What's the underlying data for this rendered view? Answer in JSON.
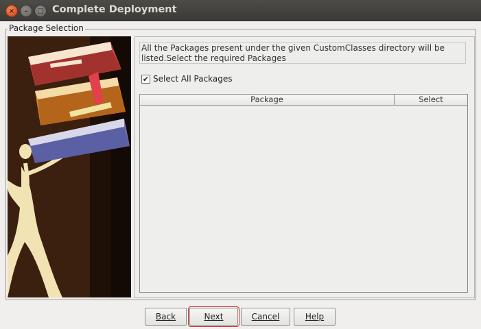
{
  "window": {
    "title": "Complete Deployment"
  },
  "title_buttons": {
    "close": "×",
    "minimize": "–",
    "maximize": "□"
  },
  "package_selection": {
    "legend": "Package Selection",
    "description": "All the Packages present under the given CustomClasses directory will be listed.Select the required Packages",
    "select_all": {
      "label": "Select All Packages",
      "checked": true,
      "check_mark": "✔"
    },
    "table": {
      "columns": [
        "Package",
        "Select"
      ],
      "rows": []
    }
  },
  "buttons": {
    "back": "Back",
    "next": "Next",
    "cancel": "Cancel",
    "help": "Help"
  },
  "colors": {
    "title_bar": "#3c3b37",
    "close_button": "#e05a2b",
    "focus_outline": "#c7302b"
  }
}
